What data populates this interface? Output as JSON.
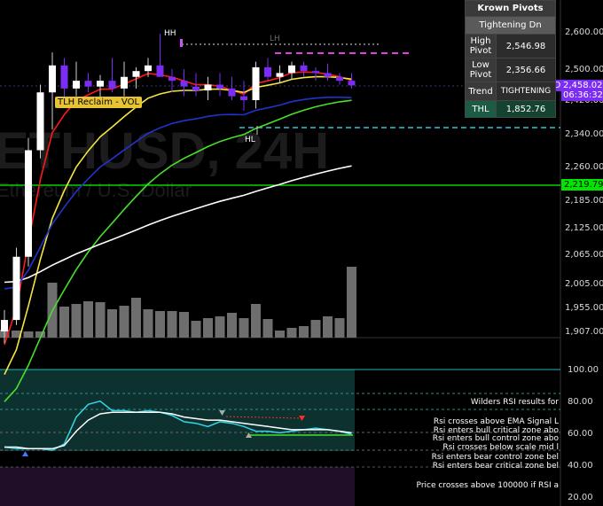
{
  "chart_data": [
    {
      "type": "candlestick",
      "title": "ETHUSD, 24H",
      "subtitle": "Ethereum / U.S. Dollar",
      "symbol": "ETHUSD",
      "last_price": "2,458.02",
      "countdown": "06:36:32",
      "y_ticks": [
        "2,600.00",
        "2,500.00",
        "2,420.00",
        "2,340.00",
        "2,260.00",
        "2,185.00",
        "2,125.00",
        "2,065.00",
        "2,005.00",
        "1,955.00",
        "1,907.00"
      ],
      "price_tag_green": "2,219.79",
      "price_tag_partial": "2,4",
      "candles": [
        {
          "o": 1907,
          "h": 1950,
          "l": 1885,
          "c": 1930
        },
        {
          "o": 1930,
          "h": 2080,
          "l": 1920,
          "c": 2060
        },
        {
          "o": 2060,
          "h": 2330,
          "l": 2040,
          "c": 2300
        },
        {
          "o": 2300,
          "h": 2460,
          "l": 2280,
          "c": 2440
        },
        {
          "o": 2440,
          "h": 2545,
          "l": 2350,
          "c": 2510
        },
        {
          "o": 2510,
          "h": 2530,
          "l": 2420,
          "c": 2450
        },
        {
          "o": 2450,
          "h": 2520,
          "l": 2430,
          "c": 2470
        },
        {
          "o": 2470,
          "h": 2490,
          "l": 2440,
          "c": 2455
        },
        {
          "o": 2455,
          "h": 2485,
          "l": 2410,
          "c": 2470
        },
        {
          "o": 2470,
          "h": 2530,
          "l": 2440,
          "c": 2450
        },
        {
          "o": 2450,
          "h": 2520,
          "l": 2430,
          "c": 2480
        },
        {
          "o": 2480,
          "h": 2505,
          "l": 2450,
          "c": 2495
        },
        {
          "o": 2495,
          "h": 2530,
          "l": 2480,
          "c": 2510
        },
        {
          "o": 2510,
          "h": 2595,
          "l": 2480,
          "c": 2480
        },
        {
          "o": 2480,
          "h": 2500,
          "l": 2440,
          "c": 2470
        },
        {
          "o": 2470,
          "h": 2500,
          "l": 2430,
          "c": 2455
        },
        {
          "o": 2455,
          "h": 2490,
          "l": 2430,
          "c": 2445
        },
        {
          "o": 2445,
          "h": 2480,
          "l": 2420,
          "c": 2460
        },
        {
          "o": 2460,
          "h": 2490,
          "l": 2430,
          "c": 2450
        },
        {
          "o": 2450,
          "h": 2480,
          "l": 2420,
          "c": 2430
        },
        {
          "o": 2430,
          "h": 2470,
          "l": 2395,
          "c": 2420
        },
        {
          "o": 2420,
          "h": 2520,
          "l": 2400,
          "c": 2505
        },
        {
          "o": 2505,
          "h": 2530,
          "l": 2470,
          "c": 2480
        },
        {
          "o": 2480,
          "h": 2510,
          "l": 2465,
          "c": 2490
        },
        {
          "o": 2490,
          "h": 2520,
          "l": 2475,
          "c": 2510
        },
        {
          "o": 2510,
          "h": 2520,
          "l": 2480,
          "c": 2495
        },
        {
          "o": 2495,
          "h": 2505,
          "l": 2470,
          "c": 2490
        },
        {
          "o": 2490,
          "h": 2515,
          "l": 2470,
          "c": 2480
        },
        {
          "o": 2480,
          "h": 2490,
          "l": 2460,
          "c": 2470
        },
        {
          "o": 2470,
          "h": 2490,
          "l": 2450,
          "c": 2458
        }
      ],
      "volume": [
        0.09,
        0.08,
        0.07,
        0.07,
        0.62,
        0.35,
        0.38,
        0.41,
        0.4,
        0.32,
        0.36,
        0.45,
        0.32,
        0.3,
        0.3,
        0.29,
        0.19,
        0.22,
        0.24,
        0.28,
        0.22,
        0.38,
        0.21,
        0.08,
        0.11,
        0.13,
        0.2,
        0.24,
        0.22,
        0.8
      ],
      "annotations": {
        "hh": "HH",
        "lh": "LH",
        "hl": "HL",
        "tlh": "TLH Reclaim - VOL"
      }
    },
    {
      "type": "line",
      "title": "Wilders RSI results for",
      "y_ticks": [
        "100.00",
        "80.00",
        "60.00",
        "40.00",
        "20.00"
      ],
      "rsi": [
        51,
        50,
        50,
        50,
        49,
        53,
        70,
        78,
        80,
        74,
        74,
        73,
        74,
        73,
        71,
        67,
        66,
        64,
        67,
        66,
        64,
        61,
        61,
        60,
        61,
        62,
        63,
        62,
        61,
        59
      ],
      "ema": [
        51,
        51,
        50,
        50,
        50,
        52,
        61,
        68,
        72,
        73,
        73,
        73,
        73,
        73,
        72,
        70,
        69,
        68,
        68,
        67,
        66,
        65,
        64,
        63,
        62,
        62,
        62,
        62,
        61,
        60
      ]
    }
  ],
  "rsi_labels": [
    "Wilders RSI results for",
    "Rsi crosses above EMA Signal L",
    "Rsi enters bull critical zone abo",
    "Rsi enters bull control zone abo",
    "Rsi crosses below scale mid l",
    "Rsi enters bear control zone bel",
    "Rsi enters bear critical zone bel",
    "Price crosses above 100000 if RSI a"
  ],
  "pivots": {
    "title": "Krown Pivots",
    "status": "Tightening Dn",
    "rows": [
      {
        "label": "High Pivot",
        "value": "2,546.98"
      },
      {
        "label": "Low Pivot",
        "value": "2,356.66"
      },
      {
        "label": "Trend",
        "value": "TIGHTENING"
      }
    ],
    "thl": {
      "label": "THL",
      "value": "1,852.76"
    }
  },
  "colors": {
    "up": "#ffffff",
    "down": "#7b2cf5",
    "ema_red": "#ff1a1a",
    "ema_yellow": "#f5e642",
    "ema_green": "#47e02a",
    "sma_white": "#ffffff",
    "rsi_cyan": "#33d6e6",
    "level_green": "#00ff00"
  }
}
